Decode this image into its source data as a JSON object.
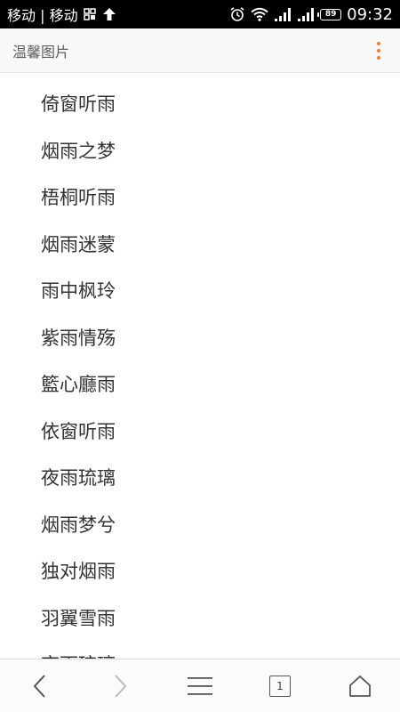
{
  "status_bar": {
    "carrier": "移动 | 移动",
    "battery_level": "89",
    "time": "09:32",
    "icons": [
      "network-grid-icon",
      "upload-arrow-icon",
      "alarm-icon",
      "wifi-icon",
      "signal-icon",
      "signal-icon",
      "battery-icon"
    ]
  },
  "header": {
    "title": "温馨图片",
    "menu_icon": "overflow-menu-icon",
    "accent_color": "#f0822a"
  },
  "list": {
    "items": [
      "倚窗听雨",
      "烟雨之梦",
      "梧桐听雨",
      "烟雨迷蒙",
      "雨中枫玲",
      "紫雨情殇",
      "籃心廳雨",
      "依窗听雨",
      "夜雨琉璃",
      "烟雨梦兮",
      "独对烟雨",
      "羽翼雪雨",
      "夜雨琉璃"
    ]
  },
  "toolbar": {
    "back_icon": "chevron-left-icon",
    "forward_icon": "chevron-right-icon",
    "menu_icon": "hamburger-menu-icon",
    "tab_count": "1",
    "home_icon": "home-icon"
  }
}
